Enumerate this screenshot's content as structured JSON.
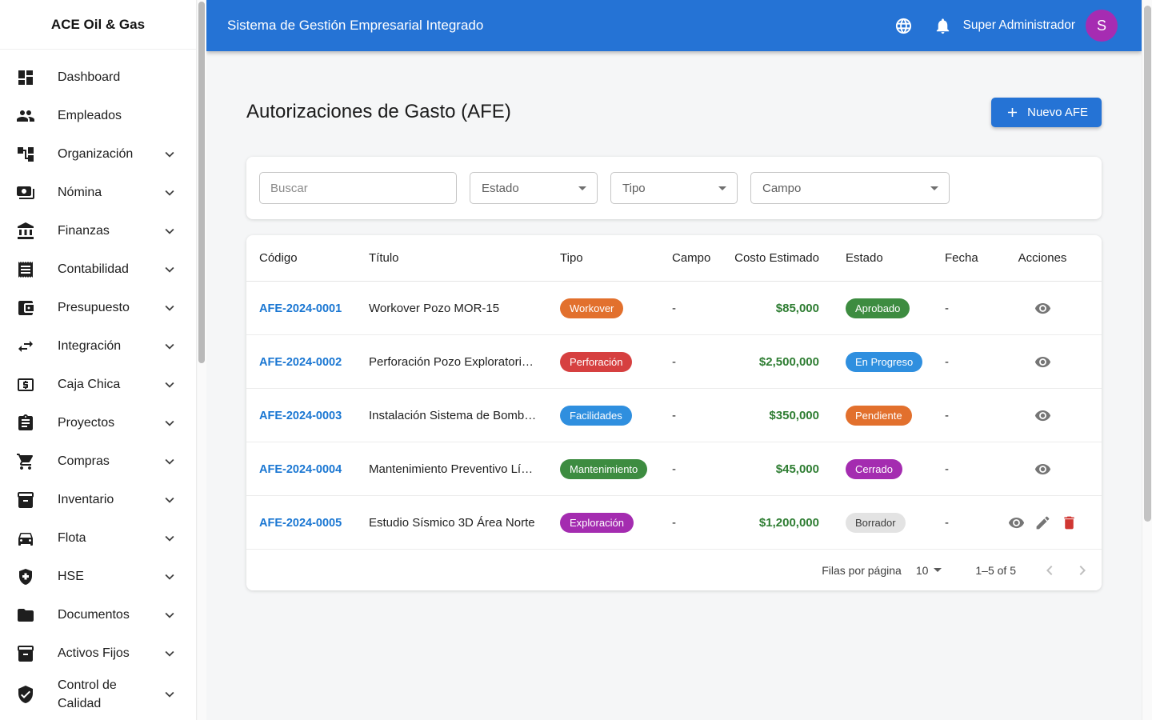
{
  "app": {
    "name": "ACE Oil & Gas",
    "title": "Sistema de Gestión Empresarial Integrado",
    "user": "Super Administrador",
    "avatar_initial": "S",
    "topbar_icons": [
      "globe-icon",
      "bell-icon"
    ]
  },
  "colors": {
    "primary": "#2573d5",
    "avatar": "#a62cb2",
    "link": "#1976d2",
    "money_green": "#2e7d32",
    "chip_orange": "#e2702d",
    "chip_red": "#d64040",
    "chip_blue": "#2f8fdf",
    "chip_green": "#3d8c40",
    "chip_purple": "#a42cb0",
    "chip_gray": "#e3e3e3"
  },
  "sidebar": {
    "items": [
      {
        "id": "dashboard",
        "label": "Dashboard",
        "icon": "dashboard",
        "expandable": false
      },
      {
        "id": "empleados",
        "label": "Empleados",
        "icon": "people",
        "expandable": false
      },
      {
        "id": "organizacion",
        "label": "Organización",
        "icon": "org-tree",
        "expandable": true
      },
      {
        "id": "nomina",
        "label": "Nómina",
        "icon": "payments",
        "expandable": true
      },
      {
        "id": "finanzas",
        "label": "Finanzas",
        "icon": "bank",
        "expandable": true
      },
      {
        "id": "contabilidad",
        "label": "Contabilidad",
        "icon": "receipt",
        "expandable": true
      },
      {
        "id": "presupuesto",
        "label": "Presupuesto",
        "icon": "wallet",
        "expandable": true
      },
      {
        "id": "integracion",
        "label": "Integración",
        "icon": "swap-arrows",
        "expandable": true
      },
      {
        "id": "caja-chica",
        "label": "Caja Chica",
        "icon": "cash-box",
        "expandable": true
      },
      {
        "id": "proyectos",
        "label": "Proyectos",
        "icon": "clipboard",
        "expandable": true
      },
      {
        "id": "compras",
        "label": "Compras",
        "icon": "shopping-cart",
        "expandable": true
      },
      {
        "id": "inventario",
        "label": "Inventario",
        "icon": "inventory-box",
        "expandable": true
      },
      {
        "id": "flota",
        "label": "Flota",
        "icon": "car",
        "expandable": true
      },
      {
        "id": "hse",
        "label": "HSE",
        "icon": "shield-plus",
        "expandable": true
      },
      {
        "id": "documentos",
        "label": "Documentos",
        "icon": "folder",
        "expandable": true
      },
      {
        "id": "activos-fijos",
        "label": "Activos Fijos",
        "icon": "inventory-box",
        "expandable": true
      },
      {
        "id": "control-calidad",
        "label": "Control de Calidad",
        "icon": "shield-check",
        "expandable": true
      }
    ]
  },
  "page": {
    "title": "Autorizaciones de Gasto (AFE)",
    "new_button_label": "Nuevo AFE"
  },
  "filters": {
    "search_placeholder": "Buscar",
    "selects": [
      {
        "label": "Estado"
      },
      {
        "label": "Tipo"
      },
      {
        "label": "Campo"
      }
    ]
  },
  "table": {
    "columns": [
      "Código",
      "Título",
      "Tipo",
      "Campo",
      "Costo Estimado",
      "Estado",
      "Fecha",
      "Acciones"
    ],
    "action_icons": {
      "view": "eye-icon",
      "edit": "pencil-icon",
      "delete": "trash-icon"
    },
    "rows": [
      {
        "code": "AFE-2024-0001",
        "title": "Workover Pozo MOR-15",
        "type": {
          "label": "Workover",
          "color": "#e2702d"
        },
        "field": "-",
        "cost": "$85,000",
        "status": {
          "label": "Aprobado",
          "color": "#3d8c40",
          "text": "#ffffff"
        },
        "date": "-",
        "actions": [
          "view"
        ]
      },
      {
        "code": "AFE-2024-0002",
        "title": "Perforación Pozo Exploratori…",
        "type": {
          "label": "Perforación",
          "color": "#d64040"
        },
        "field": "-",
        "cost": "$2,500,000",
        "status": {
          "label": "En Progreso",
          "color": "#2f8fdf",
          "text": "#ffffff"
        },
        "date": "-",
        "actions": [
          "view"
        ]
      },
      {
        "code": "AFE-2024-0003",
        "title": "Instalación Sistema de Bomb…",
        "type": {
          "label": "Facilidades",
          "color": "#2f8fdf"
        },
        "field": "-",
        "cost": "$350,000",
        "status": {
          "label": "Pendiente",
          "color": "#e2702d",
          "text": "#ffffff"
        },
        "date": "-",
        "actions": [
          "view"
        ]
      },
      {
        "code": "AFE-2024-0004",
        "title": "Mantenimiento Preventivo Lí…",
        "type": {
          "label": "Mantenimiento",
          "color": "#3d8c40"
        },
        "field": "-",
        "cost": "$45,000",
        "status": {
          "label": "Cerrado",
          "color": "#a42cb0",
          "text": "#ffffff"
        },
        "date": "-",
        "actions": [
          "view"
        ]
      },
      {
        "code": "AFE-2024-0005",
        "title": "Estudio Sísmico 3D Área Norte",
        "type": {
          "label": "Exploración",
          "color": "#a42cb0"
        },
        "field": "-",
        "cost": "$1,200,000",
        "status": {
          "label": "Borrador",
          "color": "#e3e3e3",
          "text": "#3c3c3c"
        },
        "date": "-",
        "actions": [
          "view",
          "edit",
          "delete"
        ]
      }
    ]
  },
  "pagination": {
    "rows_per_page_label": "Filas por página",
    "rows_per_page": "10",
    "range": "1–5 of 5"
  }
}
